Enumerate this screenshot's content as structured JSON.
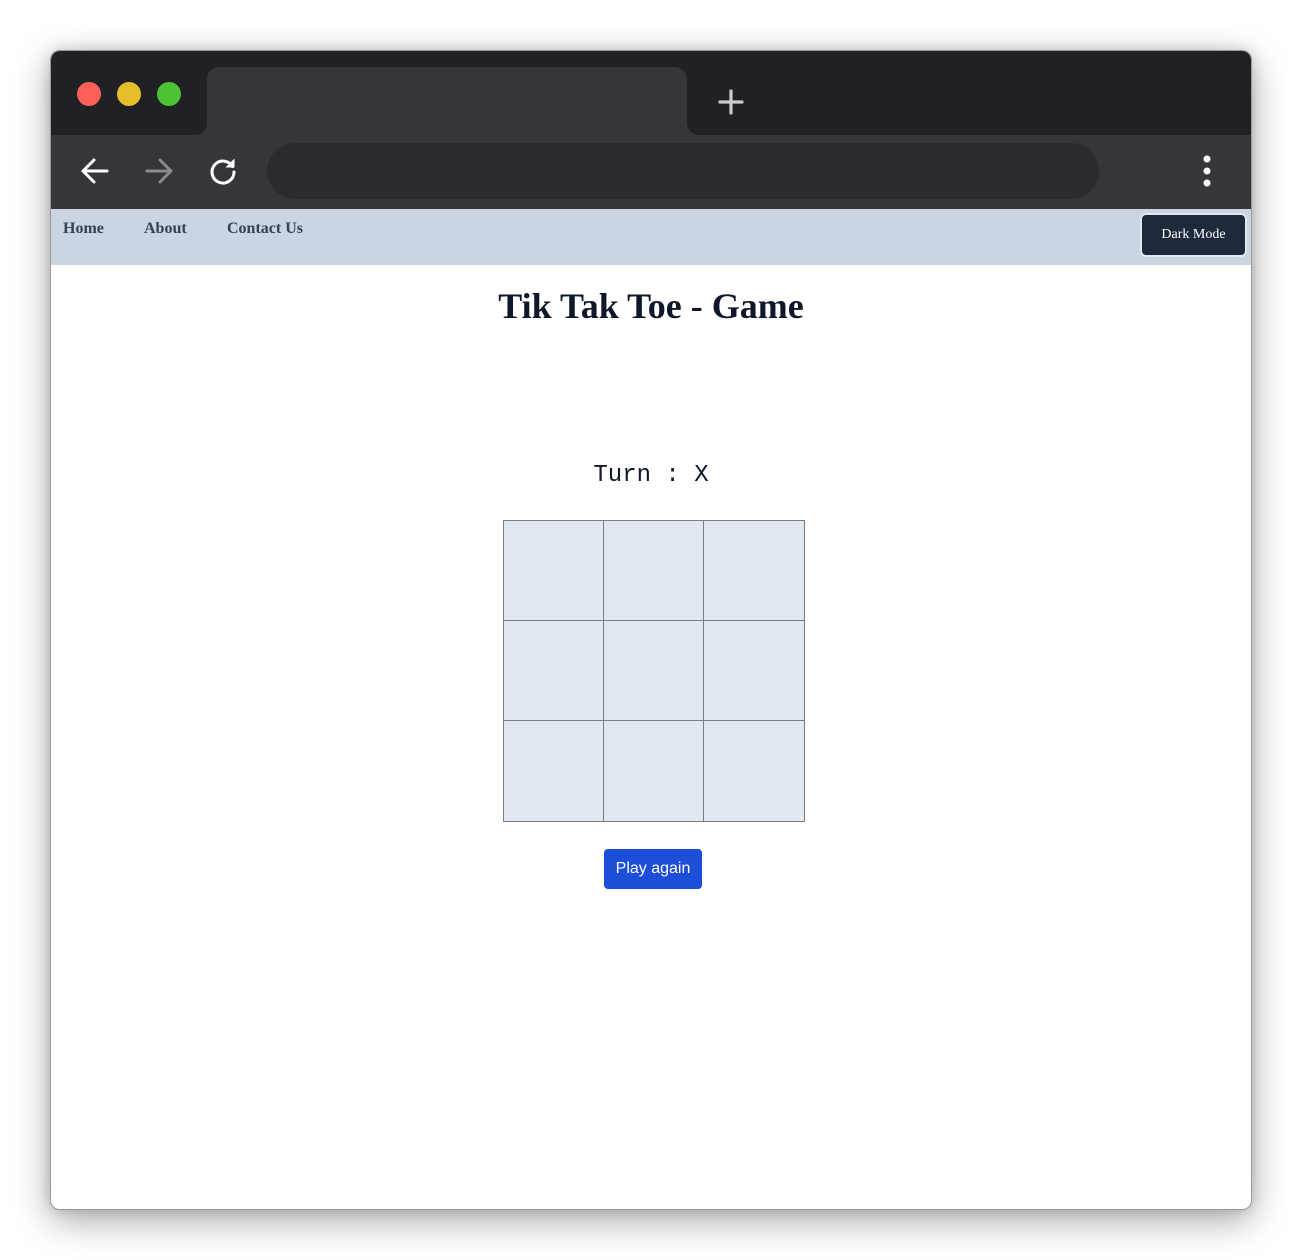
{
  "browser": {
    "tab_title": "",
    "address_value": "",
    "address_placeholder": "",
    "colors": {
      "close": "#ff5f57",
      "minimize": "#e6bd2a",
      "maximize": "#4cc234",
      "titlebar": "#202124",
      "toolbar": "#35363a"
    },
    "icons": {
      "new_tab": "plus-icon",
      "back": "arrow-left-icon",
      "forward": "arrow-right-icon",
      "reload": "reload-icon",
      "menu": "more-vertical-icon"
    }
  },
  "site_nav": {
    "links": [
      "Home",
      "About",
      "Contact Us"
    ],
    "dark_mode_label": "Dark Mode",
    "background": "#cbd5e1"
  },
  "game": {
    "title": "Tik Tak Toe - Game",
    "turn_label": "Turn : X",
    "board": [
      "",
      "",
      "",
      "",
      "",
      "",
      "",
      "",
      ""
    ],
    "cell_color": "#e2e8f0",
    "play_again_label": "Play again",
    "play_again_color": "#1d4ed8"
  }
}
